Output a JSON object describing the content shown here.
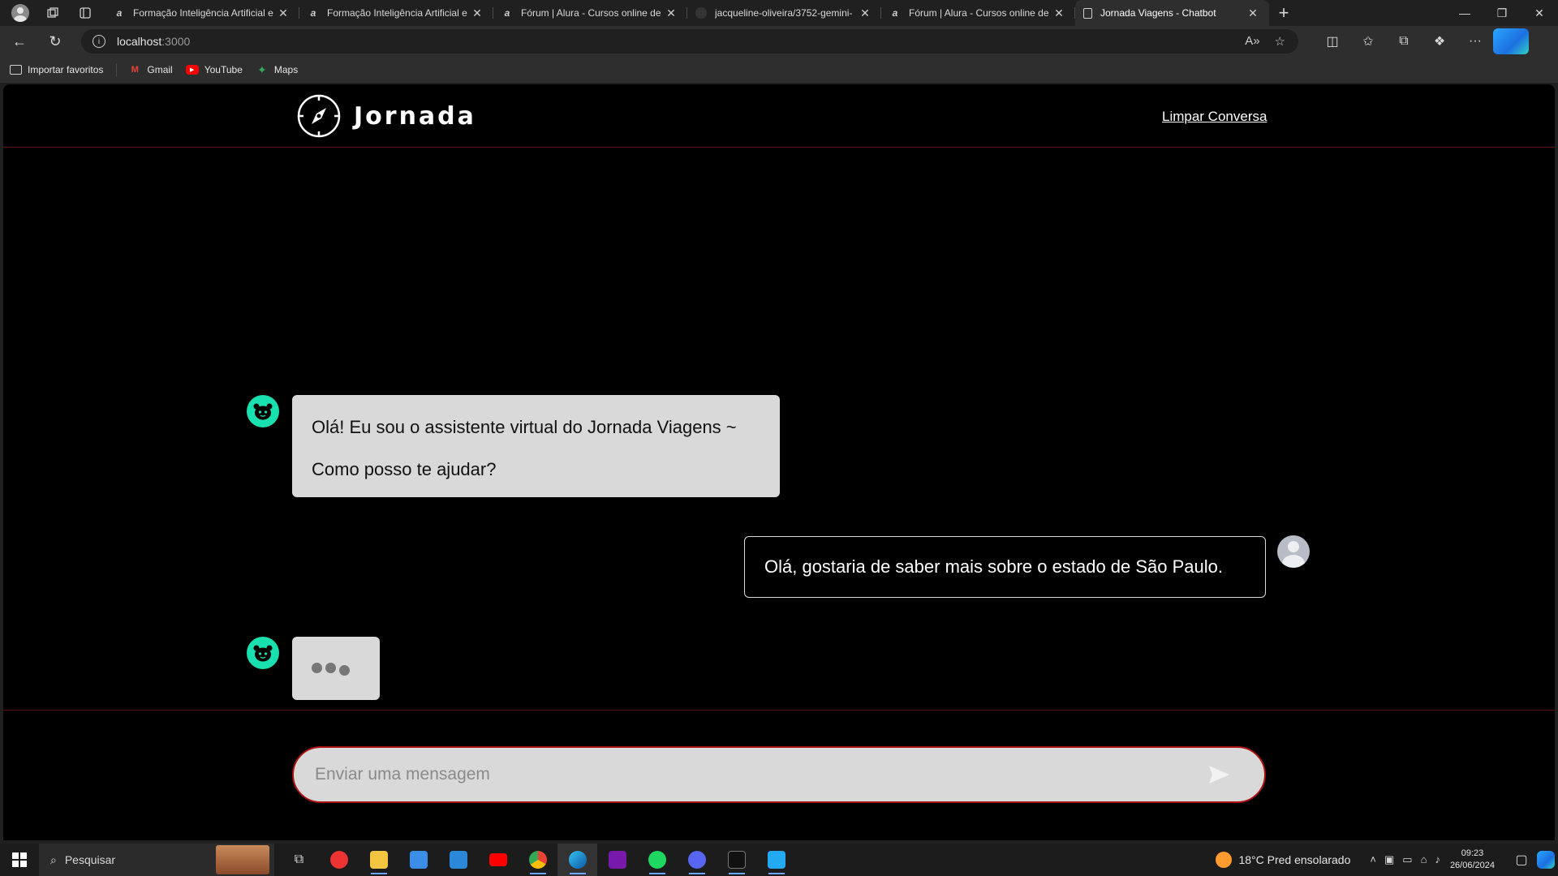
{
  "browser": {
    "tabs": [
      {
        "title": "Formação Inteligência Artificial e",
        "favicon": "alura-icon"
      },
      {
        "title": "Formação Inteligência Artificial e",
        "favicon": "alura-icon"
      },
      {
        "title": "Fórum | Alura - Cursos online de",
        "favicon": "alura-icon"
      },
      {
        "title": "jacqueline-oliveira/3752-gemini-",
        "favicon": "github-icon"
      },
      {
        "title": "Fórum | Alura - Cursos online de",
        "favicon": "alura-icon"
      },
      {
        "title": "Jornada Viagens - Chatbot",
        "favicon": "document-icon",
        "active": true
      }
    ],
    "address": {
      "host": "localhost",
      "port": ":3000"
    },
    "bookmarks": [
      {
        "label": "Importar favoritos",
        "icon": "import-icon"
      },
      {
        "label": "Gmail",
        "icon": "gmail-icon"
      },
      {
        "label": "YouTube",
        "icon": "youtube-icon"
      },
      {
        "label": "Maps",
        "icon": "maps-icon"
      }
    ]
  },
  "site": {
    "logo_text": "Jornada",
    "clear_link": "Limpar Conversa"
  },
  "chat": {
    "messages": [
      {
        "from": "bot",
        "lines": [
          "Olá! Eu sou o assistente virtual do Jornada Viagens ~",
          "Como posso te ajudar?"
        ]
      },
      {
        "from": "user",
        "lines": [
          "Olá, gostaria de saber mais sobre o estado de São Paulo."
        ]
      },
      {
        "from": "bot",
        "typing": true
      }
    ],
    "input_placeholder": "Enviar uma mensagem"
  },
  "taskbar": {
    "search_placeholder": "Pesquisar",
    "weather": "18°C  Pred ensolarado",
    "time": "09:23",
    "date": "26/06/2024"
  },
  "colors": {
    "accent_teal": "#18e0ae",
    "divider_red": "#5a1414",
    "bubble_gray": "#d9d9d9"
  }
}
